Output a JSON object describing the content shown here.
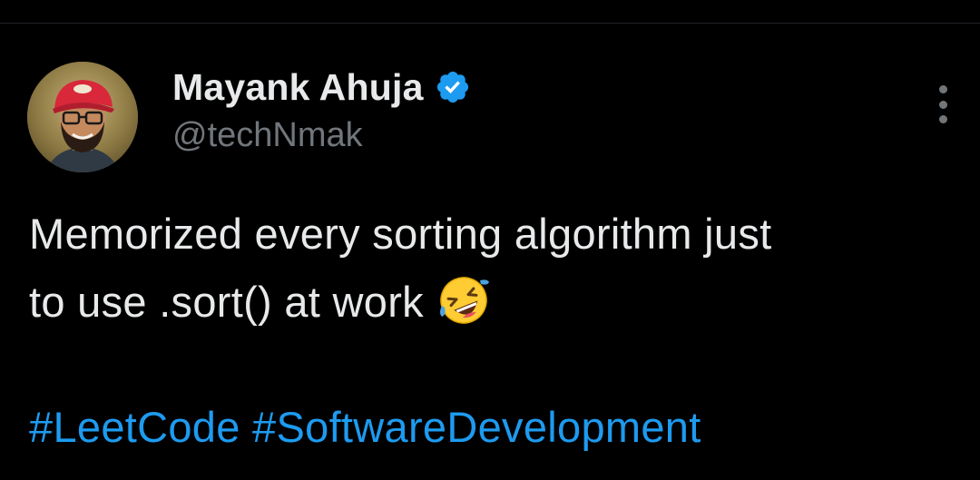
{
  "tweet": {
    "author": {
      "display_name": "Mayank Ahuja",
      "handle": "@techNmak",
      "verified": true
    },
    "text": {
      "line1": "Memorized every sorting algorithm just",
      "line2": "to use .sort() at work",
      "emoji": "rolling-on-the-floor-laughing-icon"
    },
    "hashtags": [
      "#LeetCode",
      "#SoftwareDevelopment"
    ]
  },
  "colors": {
    "background": "#000000",
    "primary_text": "#e7e9ea",
    "secondary_text": "#71767b",
    "hashtag": "#1d9bf0",
    "verified_badge": "#1d9bf0"
  }
}
